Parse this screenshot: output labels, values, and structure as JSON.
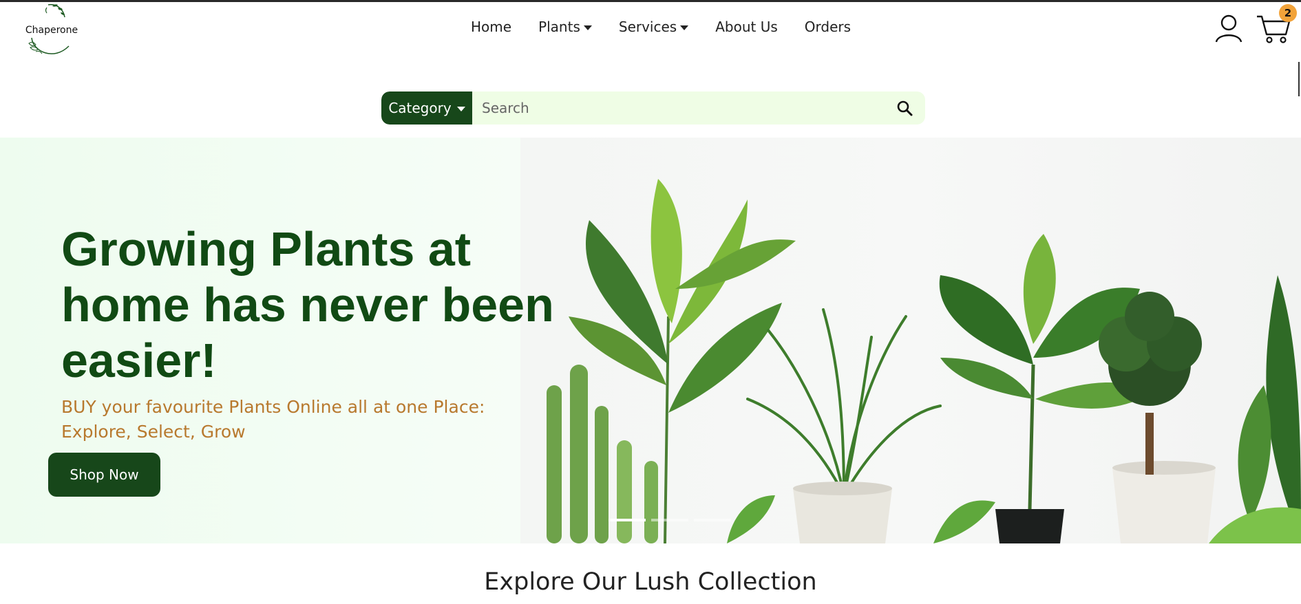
{
  "header": {
    "logo_text": "Chaperone",
    "nav": [
      {
        "label": "Home",
        "dropdown": false
      },
      {
        "label": "Plants",
        "dropdown": true
      },
      {
        "label": "Services",
        "dropdown": true
      },
      {
        "label": "About Us",
        "dropdown": false
      },
      {
        "label": "Orders",
        "dropdown": false
      }
    ],
    "account_icon": "user-icon",
    "cart_icon": "shopping-cart-icon",
    "cart_count": "2"
  },
  "search": {
    "category_label": "Category",
    "placeholder": "Search",
    "icon": "search-icon"
  },
  "hero": {
    "title": "Growing Plants at home has never been easier!",
    "subtitle": "BUY your favourite Plants Online all at one Place: Explore, Select, Grow",
    "cta_label": "Shop Now",
    "slide_count": 3,
    "active_slide": 0
  },
  "section": {
    "title": "Explore Our Lush Collection"
  },
  "colors": {
    "brand_green": "#17471a",
    "title_green": "#114a14",
    "accent_orange": "#b8792e",
    "badge_orange": "#f2a33a",
    "search_bg": "#effde5",
    "hero_bg": "#f1fdf2"
  }
}
